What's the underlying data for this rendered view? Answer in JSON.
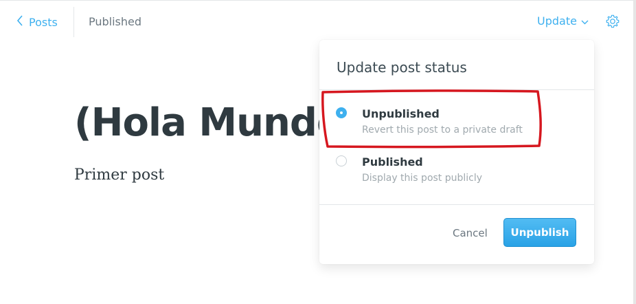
{
  "header": {
    "back_label": "Posts",
    "status": "Published",
    "update_label": "Update"
  },
  "post": {
    "title": "(Hola Mundo",
    "body": "Primer post"
  },
  "popover": {
    "title": "Update post status",
    "options": [
      {
        "label": "Unpublished",
        "description": "Revert this post to a private draft",
        "selected": true
      },
      {
        "label": "Published",
        "description": "Display this post publicly",
        "selected": false
      }
    ],
    "cancel_label": "Cancel",
    "confirm_label": "Unpublish"
  },
  "colors": {
    "accent": "#3eb0ef",
    "text": "#2f3a40",
    "muted": "#a0a9ae",
    "annotation": "#d6171f"
  },
  "icons": {
    "back": "chevron-left-icon",
    "update": "chevron-down-icon",
    "settings": "gear-icon"
  }
}
